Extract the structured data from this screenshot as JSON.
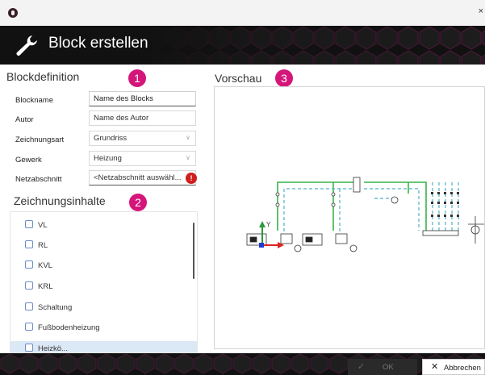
{
  "header": {
    "title": "Block erstellen"
  },
  "window": {
    "close_glyph": "×"
  },
  "blockdefinition": {
    "title": "Blockdefinition",
    "badge": "1",
    "fields": [
      {
        "label": "Blockname",
        "value": "Name des Blocks"
      },
      {
        "label": "Autor",
        "value": "Name des Autor"
      },
      {
        "label": "Zeichnungsart",
        "value": "Grundriss"
      },
      {
        "label": "Gewerk",
        "value": "Heizung"
      },
      {
        "label": "Netzabschnitt",
        "value": "<Netzabschnitt auswähl..."
      }
    ],
    "error_glyph": "!"
  },
  "zeichnungsinhalte": {
    "title": "Zeichnungsinhalte",
    "badge": "2",
    "items": [
      "VL",
      "RL",
      "KVL",
      "KRL",
      "Schaltung",
      "Fußbodenheizung",
      "Heizkö..."
    ]
  },
  "vorschau": {
    "title": "Vorschau",
    "badge": "3",
    "axis_y": "Y"
  },
  "footer": {
    "ok_label": "OK",
    "cancel_label": "Abbrechen"
  },
  "colors": {
    "accent_badge": "#d4167a",
    "header_bg": "#111111",
    "error": "#d01e1e"
  }
}
